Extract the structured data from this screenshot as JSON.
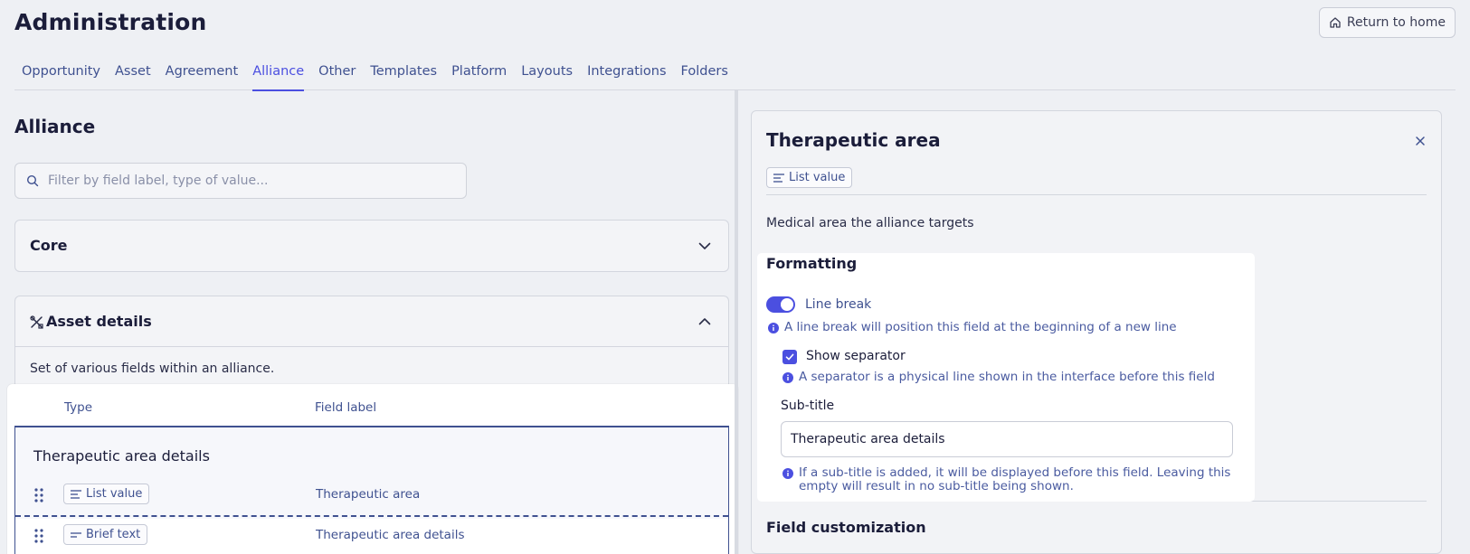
{
  "header": {
    "title": "Administration",
    "return_label": "Return to home"
  },
  "tabs": [
    {
      "label": "Opportunity",
      "active": false
    },
    {
      "label": "Asset",
      "active": false
    },
    {
      "label": "Agreement",
      "active": false
    },
    {
      "label": "Alliance",
      "active": true
    },
    {
      "label": "Other",
      "active": false
    },
    {
      "label": "Templates",
      "active": false
    },
    {
      "label": "Platform",
      "active": false
    },
    {
      "label": "Layouts",
      "active": false
    },
    {
      "label": "Integrations",
      "active": false
    },
    {
      "label": "Folders",
      "active": false
    }
  ],
  "left": {
    "section_title": "Alliance",
    "filter_placeholder": "Filter by field label, type of value...",
    "core_title": "Core",
    "asset_title": "Asset details",
    "asset_description": "Set of various fields within an alliance.",
    "table": {
      "col_type": "Type",
      "col_label": "Field label",
      "group_title": "Therapeutic area details",
      "rows": [
        {
          "type": "List value",
          "label": "Therapeutic area"
        },
        {
          "type": "Brief text",
          "label": "Therapeutic area details"
        }
      ]
    }
  },
  "right": {
    "title": "Therapeutic area",
    "type_chip": "List value",
    "description": "Medical area the alliance targets",
    "formatting": {
      "title": "Formatting",
      "line_break_label": "Line break",
      "line_break_on": true,
      "line_break_hint": "A line break will position this field at the beginning of a new line",
      "separator_label": "Show separator",
      "separator_checked": true,
      "separator_hint": "A separator is a physical line shown in the interface before this field",
      "subtitle_label": "Sub-title",
      "subtitle_value": "Therapeutic area details",
      "subtitle_hint": "If a sub-title is added, it will be displayed before this field. Leaving this empty will result in no sub-title being shown."
    },
    "field_customization_title": "Field customization"
  },
  "colors": {
    "accent": "#4b4fe0",
    "link_text": "#3f5190",
    "heading": "#1b1d3a"
  }
}
